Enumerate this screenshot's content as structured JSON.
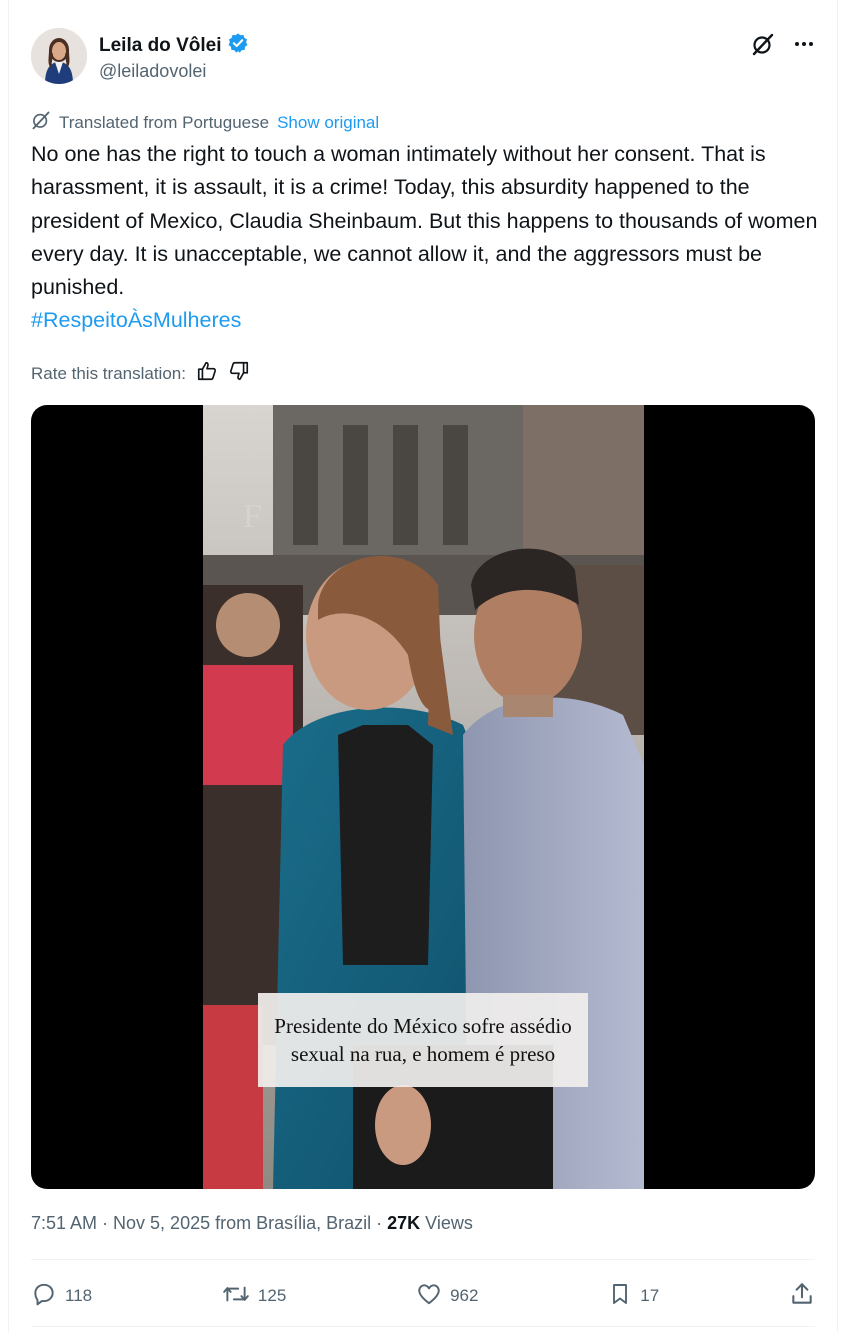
{
  "author": {
    "name": "Leila do Vôlei",
    "handle": "@leiladovolei",
    "verified": true,
    "verified_color": "#1d9bf0"
  },
  "translation": {
    "label": "Translated from Portuguese",
    "show_original": "Show original",
    "rate_label": "Rate this translation:"
  },
  "tweet": {
    "text": "No one has the right to touch a woman intimately without her consent. That is harassment, it is assault, it is a crime! Today, this absurdity happened to the president of Mexico, Claudia Sheinbaum. But this happens to thousands of women every day. It is unacceptable, we cannot allow it, and the aggressors must be punished.",
    "hashtag": "#RespeitoÀsMulheres"
  },
  "media": {
    "caption": "Presidente do México sofre assédio sexual na rua, e homem é preso",
    "watermark": "F"
  },
  "meta": {
    "timestamp": "7:51 AM · Nov 5, 2025 from Brasília, Brazil · ",
    "views_count": "27K",
    "views_label": " Views"
  },
  "actions": {
    "replies": "118",
    "reposts": "125",
    "likes": "962",
    "bookmarks": "17"
  },
  "icons": {
    "grok": "grok-icon",
    "more": "more-icon",
    "translate": "translate-icon",
    "thumbs_up": "thumbs-up-icon",
    "thumbs_down": "thumbs-down-icon",
    "reply": "reply-icon",
    "repost": "repost-icon",
    "like": "heart-icon",
    "bookmark": "bookmark-icon",
    "share": "share-icon"
  },
  "colors": {
    "accent": "#1d9bf0",
    "secondary_text": "#536471",
    "primary_text": "#0f1419"
  }
}
